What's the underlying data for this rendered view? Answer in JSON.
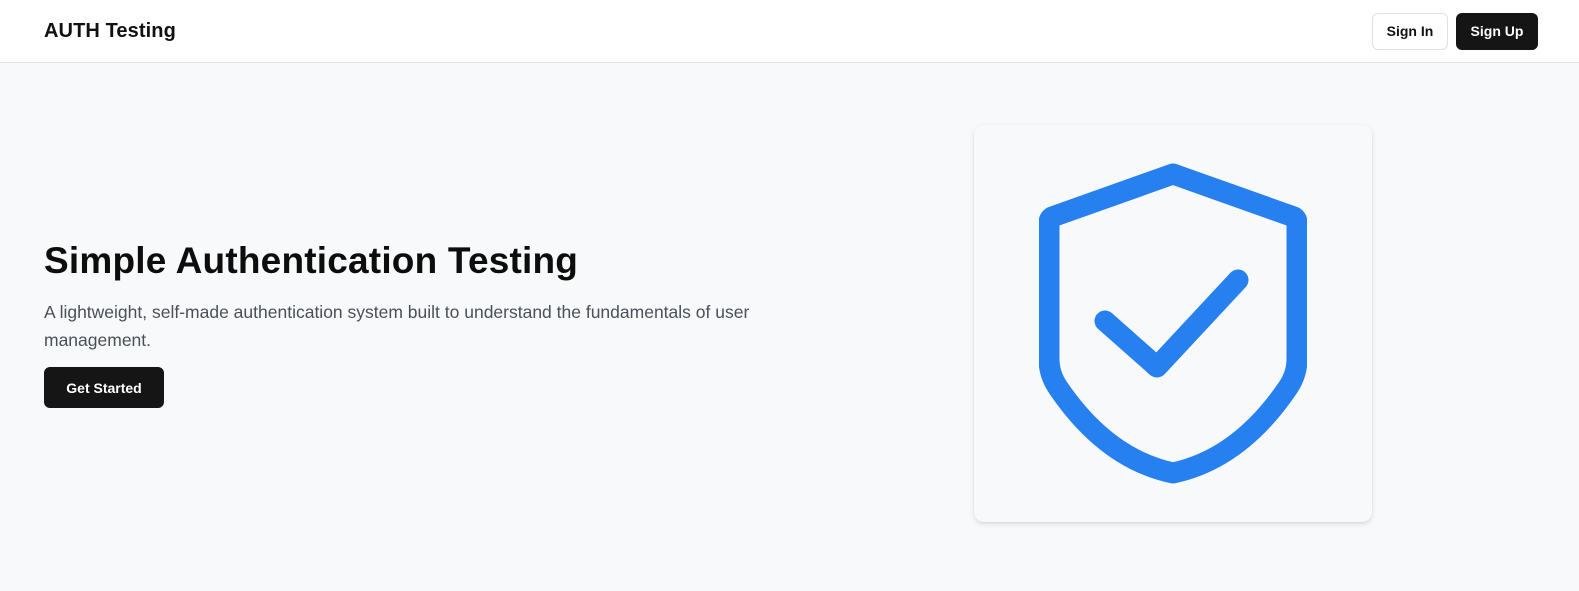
{
  "navbar": {
    "brand": "AUTH Testing",
    "sign_in_label": "Sign In",
    "sign_up_label": "Sign Up"
  },
  "hero": {
    "title": "Simple Authentication Testing",
    "description": "A lightweight, self-made authentication system built to understand the fundamentals of user management.",
    "cta_label": "Get Started"
  },
  "illustration": {
    "icon": "shield-check-icon",
    "color": "#2780ef"
  },
  "colors": {
    "primary_button": "#151515",
    "accent": "#2780ef",
    "background": "#f8f9fa"
  }
}
